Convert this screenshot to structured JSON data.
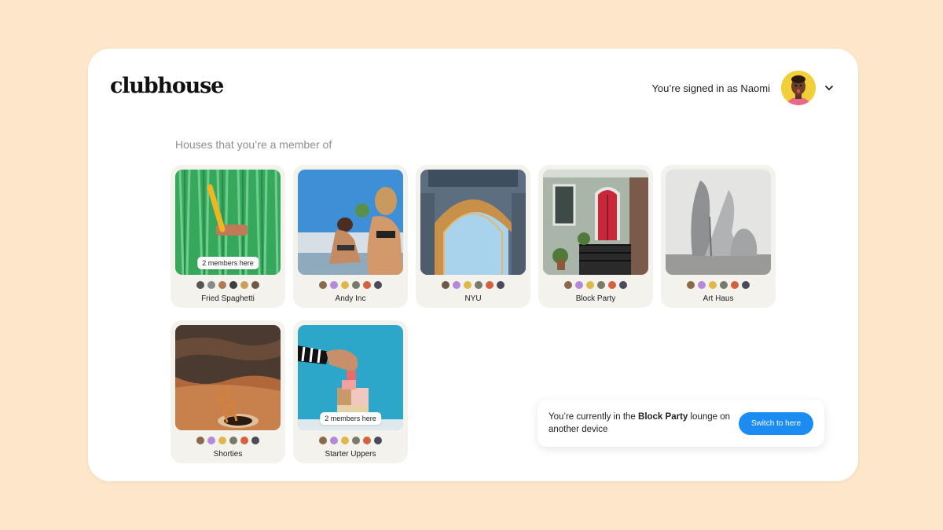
{
  "app": {
    "logo": "clubhouse",
    "signed_in_text": "You’re signed in as Naomi"
  },
  "section_title": "Houses that you’re a member of",
  "houses": [
    {
      "name": "Fried Spaghetti",
      "members_here": "2 members here",
      "image": "green-curtain-photo"
    },
    {
      "name": "Andy Inc",
      "members_here": "",
      "image": "poolside-people-photo"
    },
    {
      "name": "NYU",
      "members_here": "",
      "image": "arch-photo"
    },
    {
      "name": "Block Party",
      "members_here": "",
      "image": "townhouse-photo"
    },
    {
      "name": "Art Haus",
      "members_here": "",
      "image": "sculpture-photo"
    },
    {
      "name": "Shorties",
      "members_here": "",
      "image": "desert-ladder-photo"
    },
    {
      "name": "Starter Uppers",
      "members_here": "2 members here",
      "image": "blocks-hand-photo"
    }
  ],
  "notice": {
    "text_before": "You’re currently in the ",
    "house": "Block Party",
    "text_after": " lounge on another device",
    "button": "Switch to here"
  },
  "colors": {
    "background": "#fde6c9",
    "accent": "#1b8cf2",
    "card": "#f4f2ec"
  }
}
